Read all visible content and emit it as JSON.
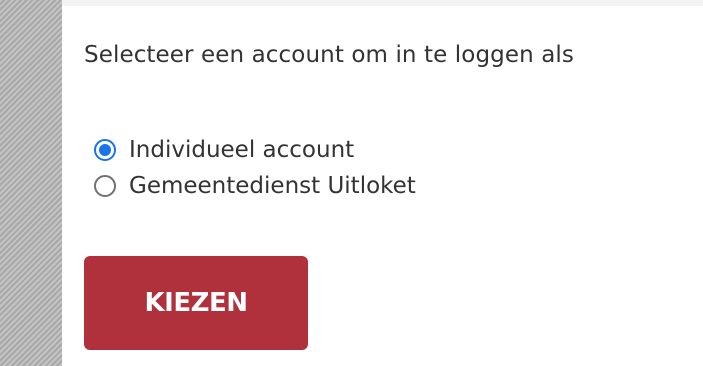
{
  "prompt": "Selecteer een account om in te loggen als",
  "account_options": [
    {
      "label": "Individueel account",
      "selected": true
    },
    {
      "label": "Gemeentedienst Uitloket",
      "selected": false
    }
  ],
  "choose_button_label": "KIEZEN",
  "colors": {
    "button_background": "#b0303b",
    "radio_accent": "#1a73e8",
    "text": "#333333"
  }
}
